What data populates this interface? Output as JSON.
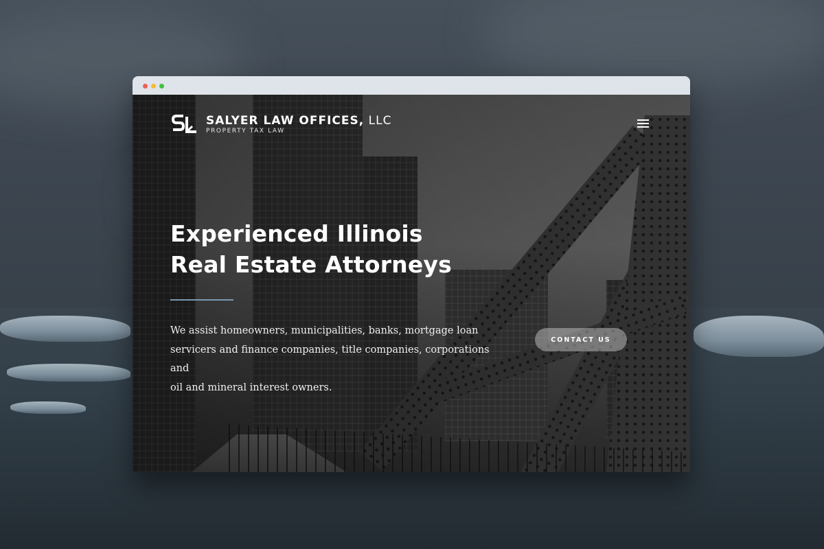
{
  "brand": {
    "name_bold": "SALYER LAW OFFICES,",
    "name_light": " LLC",
    "tagline": "PROPERTY TAX LAW",
    "logo_mark": "SL"
  },
  "nav": {
    "menu_icon": "hamburger-menu-icon"
  },
  "hero": {
    "headline_line1": "Experienced Illinois",
    "headline_line2": "Real Estate Attorneys",
    "intro_line1": "We assist homeowners, municipalities, banks, mortgage loan",
    "intro_line2": "servicers and finance companies, title companies, corporations and",
    "intro_line3": "oil and mineral interest owners.",
    "cta_label": "CONTACT US"
  },
  "colors": {
    "divider_accent": "#7d97b3",
    "text": "#ffffff"
  }
}
